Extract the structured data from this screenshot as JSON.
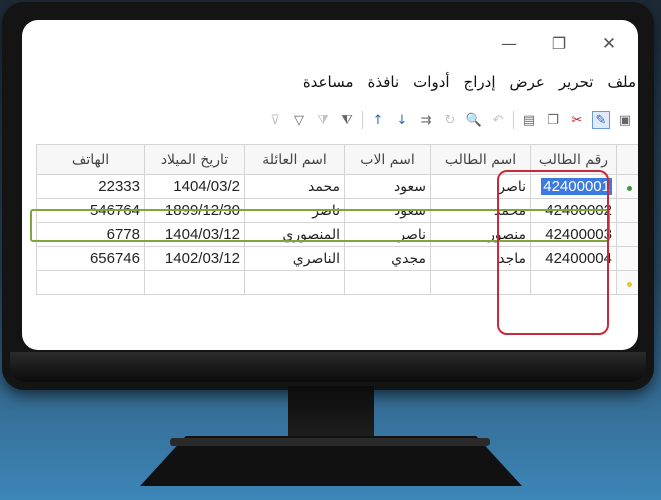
{
  "window": {
    "minimize_glyph": "—",
    "maximize_glyph": "❐",
    "close_glyph": "✕"
  },
  "menu": {
    "items": [
      {
        "label": "ملف"
      },
      {
        "label": "تحرير"
      },
      {
        "label": "عرض"
      },
      {
        "label": "إدراج"
      },
      {
        "label": "أدوات"
      },
      {
        "label": "نافذة"
      },
      {
        "label": "مساعدة"
      }
    ]
  },
  "toolbar": {
    "icons": [
      "save-icon",
      "edit-icon",
      "cut-icon",
      "copy-icon",
      "paste-icon",
      "undo-icon",
      "find-icon",
      "refresh-icon",
      "goto-icon",
      "sort-asc-icon",
      "sort-desc-icon",
      "autofilter-icon",
      "standard-filter-icon",
      "filter-icon",
      "remove-filter-icon"
    ]
  },
  "grid": {
    "columns": [
      "رقم الطالب",
      "اسم الطالب",
      "اسم الاب",
      "اسم العائلة",
      "تاريخ الميلاد",
      "الهاتف"
    ],
    "rows": [
      {
        "student_id": "42400001",
        "student_name": "ناصر",
        "father_name": "سعود",
        "family_name": "محمد",
        "birth_date": "1404/03/2",
        "phone": "22333"
      },
      {
        "student_id": "42400002",
        "student_name": "محمد",
        "father_name": "سعود",
        "family_name": "ناصر",
        "birth_date": "1899/12/30",
        "phone": "546764"
      },
      {
        "student_id": "42400003",
        "student_name": "منصور",
        "father_name": "ناصر",
        "family_name": "المنصوري",
        "birth_date": "1404/03/12",
        "phone": "6778"
      },
      {
        "student_id": "42400004",
        "student_name": "ماجد",
        "father_name": "مجدي",
        "family_name": "الناصري",
        "birth_date": "1402/03/12",
        "phone": "656746"
      }
    ]
  },
  "colors": {
    "selection": "#3b7ae0",
    "row_highlight": "#7fa63a",
    "column_highlight": "#c9293a"
  }
}
